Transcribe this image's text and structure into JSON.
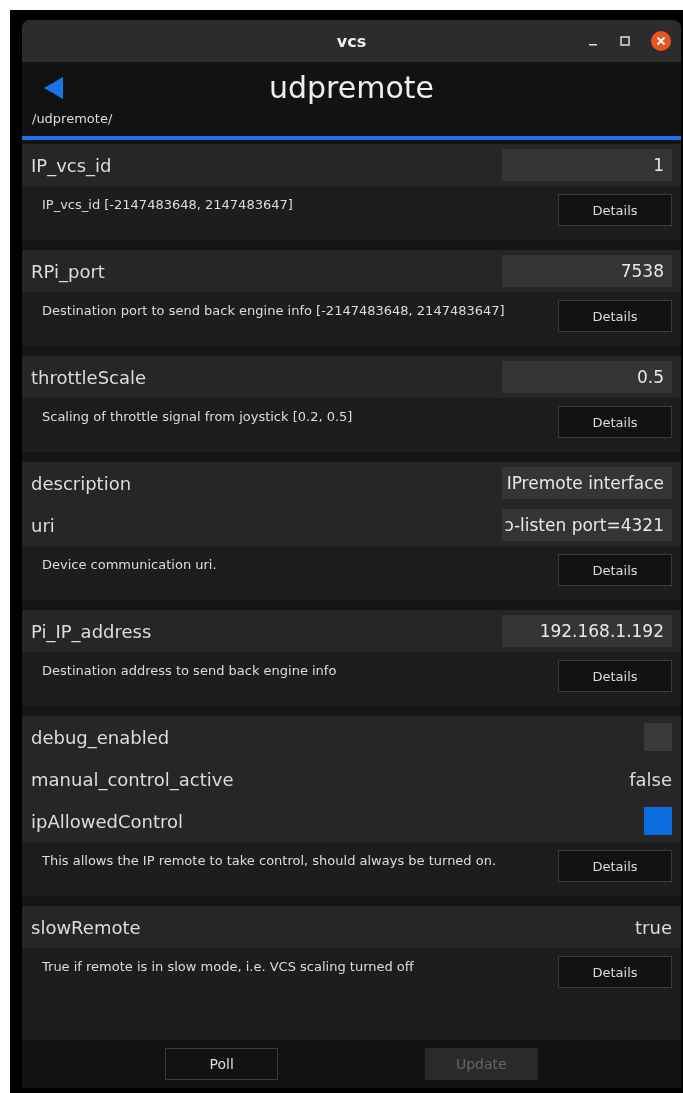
{
  "window": {
    "title": "vcs"
  },
  "header": {
    "title": "udpremote",
    "path": "/udpremote/"
  },
  "groups": [
    {
      "params": [
        {
          "name": "IP_vcs_id",
          "kind": "field",
          "value": "1"
        }
      ],
      "description": "IP_vcs_id [-2147483648, 2147483647]",
      "details": "Details"
    },
    {
      "params": [
        {
          "name": "RPi_port",
          "kind": "field",
          "value": "7538"
        }
      ],
      "description": "Destination port to send back engine info [-2147483648, 2147483647]",
      "details": "Details"
    },
    {
      "params": [
        {
          "name": "throttleScale",
          "kind": "field",
          "value": "0.5"
        }
      ],
      "description": "Scaling of throttle signal from joystick [0.2, 0.5]",
      "details": "Details"
    },
    {
      "params": [
        {
          "name": "description",
          "kind": "field",
          "value": "IPremote interface"
        },
        {
          "name": "uri",
          "kind": "field",
          "value": "ɔ-listen port=4321"
        }
      ],
      "description": "Device communication uri.",
      "details": "Details"
    },
    {
      "params": [
        {
          "name": "Pi_IP_address",
          "kind": "field",
          "value": "192.168.1.192"
        }
      ],
      "description": "Destination address to send back engine info",
      "details": "Details"
    },
    {
      "params": [
        {
          "name": "debug_enabled",
          "kind": "checkbox",
          "checked": false
        },
        {
          "name": "manual_control_active",
          "kind": "text",
          "value": "false"
        },
        {
          "name": "ipAllowedControl",
          "kind": "checkbox",
          "checked": true
        }
      ],
      "description": "This allows the IP remote to take control, should always be turned on.",
      "details": "Details"
    },
    {
      "params": [
        {
          "name": "slowRemote",
          "kind": "text",
          "value": "true"
        }
      ],
      "description": "True if remote is in slow mode, i.e. VCS scaling turned off",
      "details": "Details"
    }
  ],
  "footer": [
    {
      "label": "Poll",
      "disabled": false
    },
    {
      "label": "Update",
      "disabled": true
    }
  ]
}
